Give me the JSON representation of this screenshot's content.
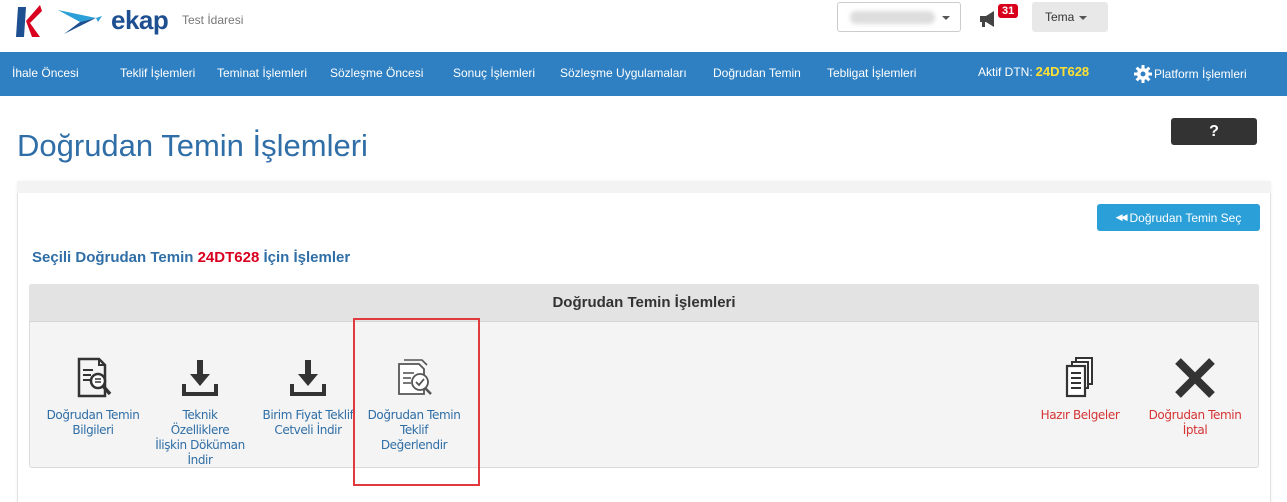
{
  "header": {
    "logo_text": "ekap",
    "org_name": "Test İdaresi",
    "notification_count": "31",
    "theme_label": "Tema"
  },
  "nav": {
    "items": [
      "İhale Öncesi",
      "Teklif İşlemleri",
      "Teminat İşlemleri",
      "Sözleşme Öncesi",
      "Sonuç İşlemleri",
      "Sözleşme Uygulamaları",
      "Doğrudan Temin",
      "Tebligat İşlemleri"
    ],
    "dtn_label": "Aktif DTN:",
    "dtn_code": "24DT628",
    "platform_label": "Platform İşlemleri"
  },
  "page": {
    "title": "Doğrudan Temin İşlemleri",
    "help_label": "?",
    "select_button": "Doğrudan Temin Seç",
    "section_prefix": "Seçili Doğrudan Temin",
    "section_code": "24DT628",
    "section_suffix": "İçin İşlemler",
    "ops_header": "Doğrudan Temin İşlemleri"
  },
  "operations": [
    {
      "lines": [
        "Doğrudan Temin",
        "Bilgileri"
      ],
      "icon": "document-search-icon",
      "color": "blue"
    },
    {
      "lines": [
        "Teknik",
        "Özelliklere",
        "İlişkin Döküman",
        "İndir"
      ],
      "icon": "download-icon",
      "color": "blue"
    },
    {
      "lines": [
        "Birim Fiyat Teklif",
        "Cetveli İndir"
      ],
      "icon": "download-icon",
      "color": "blue"
    },
    {
      "lines": [
        "Doğrudan Temin",
        "Teklif",
        "Değerlendir"
      ],
      "icon": "evaluate-offer-icon",
      "color": "blue"
    },
    {
      "lines": [
        "Hazır Belgeler"
      ],
      "icon": "documents-stack-icon",
      "color": "red"
    },
    {
      "lines": [
        "Doğrudan Temin",
        "İptal"
      ],
      "icon": "cancel-x-icon",
      "color": "red"
    }
  ],
  "colors": {
    "nav_bg": "#2f80c2",
    "title_blue": "#2f6ea6",
    "accent_red": "#d8001e",
    "dtn_yellow": "#ffe033",
    "select_btn": "#2a9fd8",
    "highlight_border": "#e0393e"
  }
}
